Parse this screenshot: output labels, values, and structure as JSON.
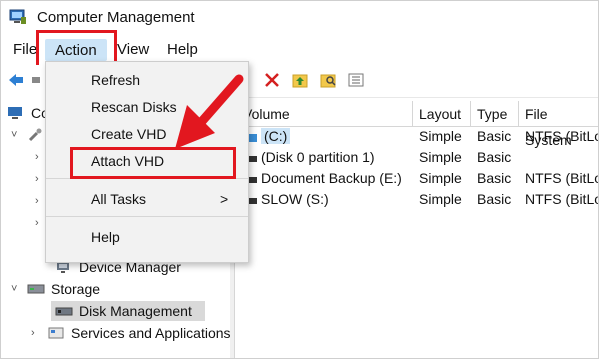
{
  "window": {
    "title": "Computer Management"
  },
  "menubar": {
    "file": "File",
    "action": "Action",
    "view": "View",
    "help": "Help"
  },
  "dropdown": {
    "refresh": "Refresh",
    "rescan": "Rescan Disks",
    "create_vhd": "Create VHD",
    "attach_vhd": "Attach VHD",
    "all_tasks": "All Tasks",
    "all_tasks_arrow": ">",
    "help": "Help"
  },
  "tree": {
    "root": "Co",
    "device_manager": "Device Manager",
    "storage": "Storage",
    "disk_management": "Disk Management",
    "services": "Services and Applications"
  },
  "table": {
    "headers": [
      "Volume",
      "Layout",
      "Type",
      "File System"
    ],
    "rows": [
      [
        "(C:)",
        "Simple",
        "Basic",
        "NTFS (BitLo"
      ],
      [
        "(Disk 0 partition 1)",
        "Simple",
        "Basic",
        ""
      ],
      [
        "Document Backup (E:)",
        "Simple",
        "Basic",
        "NTFS (BitLo"
      ],
      [
        "SLOW (S:)",
        "Simple",
        "Basic",
        "NTFS (BitLo"
      ]
    ]
  },
  "colors": {
    "accent_red": "#e2171f",
    "menu_highlight": "#cce4f7"
  },
  "icons": {
    "app": "computer-management-icon",
    "back": "back-arrow-icon",
    "toolbar": [
      "delete-icon",
      "folder-up-icon",
      "folder-search-icon",
      "list-icon"
    ],
    "callout": "red-arrow-icon"
  }
}
